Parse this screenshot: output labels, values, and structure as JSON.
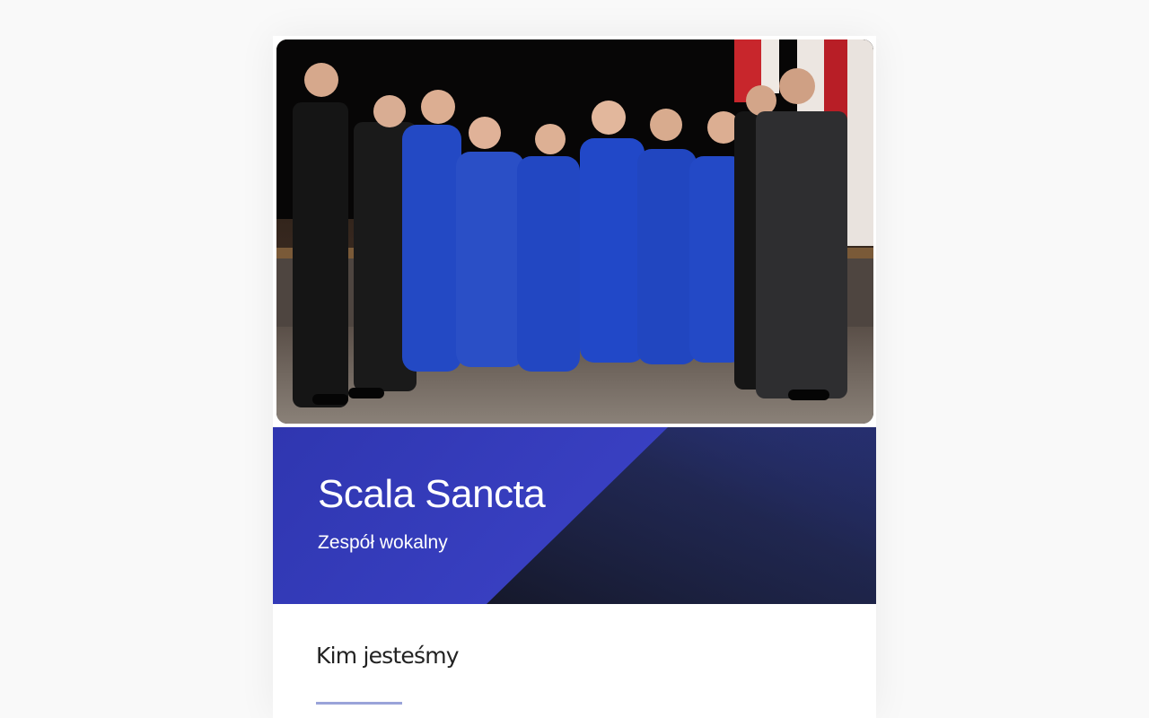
{
  "hero": {
    "image_alt": "Scala Sancta"
  },
  "banner": {
    "title": "Scala Sancta",
    "subtitle": "Zespół wokalny",
    "colors": {
      "left": "#3339b8",
      "right": "#242c62",
      "shadow": "#181c2c"
    }
  },
  "about": {
    "heading": "Kim jesteśmy",
    "rule_color": "#9aa3d9"
  }
}
